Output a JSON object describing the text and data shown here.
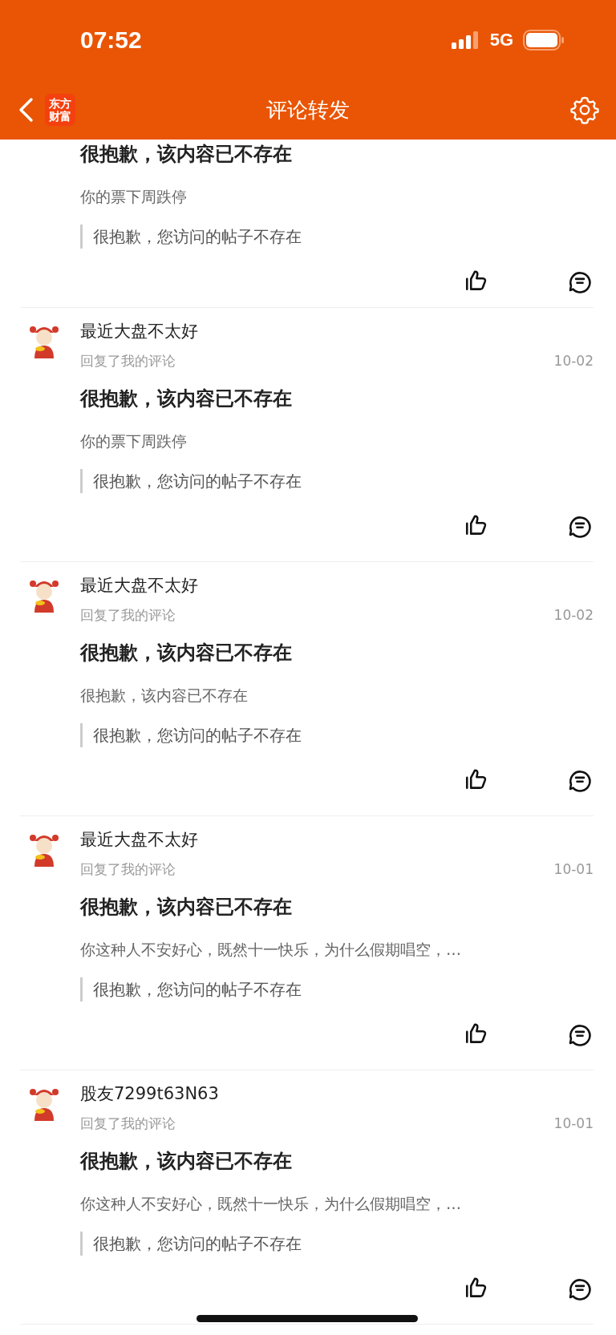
{
  "status_bar": {
    "time": "07:52",
    "network": "5G"
  },
  "nav_bar": {
    "logo": "东方财富",
    "title": "评论转发"
  },
  "comments": [
    {
      "title": "很抱歉，该内容已不存在",
      "body": "你的票下周跌停",
      "quote": "很抱歉，您访问的帖子不存在"
    },
    {
      "user": "最近大盘不太好",
      "action": "回复了我的评论",
      "date": "10-02",
      "title": "很抱歉，该内容已不存在",
      "body": "你的票下周跌停",
      "quote": "很抱歉，您访问的帖子不存在"
    },
    {
      "user": "最近大盘不太好",
      "action": "回复了我的评论",
      "date": "10-02",
      "title": "很抱歉，该内容已不存在",
      "body": "很抱歉，该内容已不存在",
      "quote": "很抱歉，您访问的帖子不存在"
    },
    {
      "user": "最近大盘不太好",
      "action": "回复了我的评论",
      "date": "10-01",
      "title": "很抱歉，该内容已不存在",
      "body": "你这种人不安好心，既然十一快乐，为什么假期唱空，…",
      "quote": "很抱歉，您访问的帖子不存在"
    },
    {
      "user": "股友7299t63N63",
      "action": "回复了我的评论",
      "date": "10-01",
      "title": "很抱歉，该内容已不存在",
      "body": "你这种人不安好心，既然十一快乐，为什么假期唱空，…",
      "quote": "很抱歉，您访问的帖子不存在"
    }
  ]
}
